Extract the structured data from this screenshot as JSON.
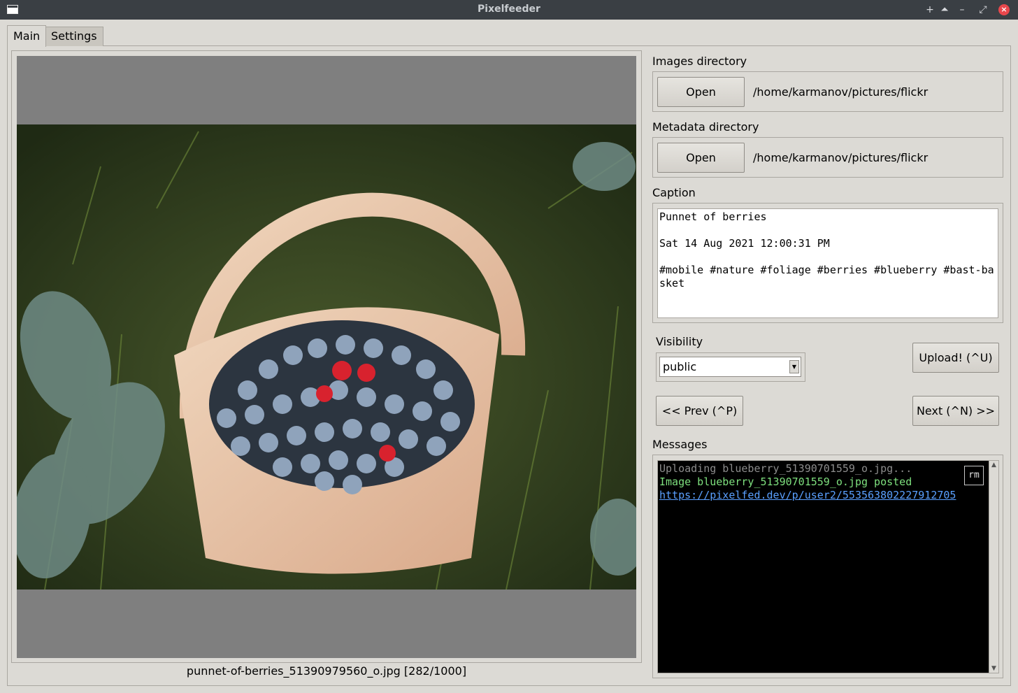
{
  "window": {
    "title": "Pixelfeeder"
  },
  "tabs": [
    {
      "label": "Main",
      "active": true
    },
    {
      "label": "Settings",
      "active": false
    }
  ],
  "image": {
    "filename_label": "punnet-of-berries_51390979560_o.jpg [282/1000]"
  },
  "images_directory": {
    "label": "Images directory",
    "open_label": "Open",
    "path": "/home/karmanov/pictures/flickr"
  },
  "metadata_directory": {
    "label": "Metadata directory",
    "open_label": "Open",
    "path": "/home/karmanov/pictures/flickr"
  },
  "caption": {
    "label": "Caption",
    "text": "Punnet of berries\n\nSat 14 Aug 2021 12:00:31 PM\n\n#mobile #nature #foliage #berries #blueberry #bast-basket"
  },
  "visibility": {
    "label": "Visibility",
    "selected": "public"
  },
  "buttons": {
    "upload": "Upload! (^U)",
    "prev": "<< Prev (^P)",
    "next": "Next (^N) >>"
  },
  "messages": {
    "label": "Messages",
    "rm_label": "rm",
    "lines": [
      "Uploading blueberry_51390701559_o.jpg...",
      "Image blueberry_51390701559_o.jpg posted",
      "https://pixelfed.dev/p/user2/553563802227912705"
    ]
  },
  "colors": {
    "background": "#dcdad5",
    "titlebar": "#3a3f44",
    "message_gray": "#8c8c8c",
    "message_green": "#7ee07e",
    "message_link": "#5aa0ff"
  }
}
